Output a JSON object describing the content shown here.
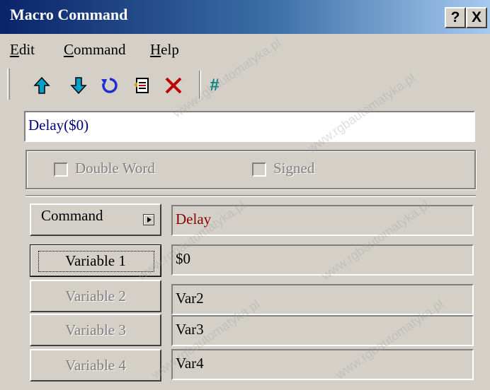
{
  "window": {
    "title": "Macro Command",
    "help_btn": "?",
    "close_btn": "X"
  },
  "menu": {
    "items": [
      {
        "label": "Edit",
        "accel": "E",
        "rest": "dit"
      },
      {
        "label": "Command",
        "accel": "C",
        "rest": "ommand"
      },
      {
        "label": "Help",
        "accel": "H",
        "rest": "elp"
      }
    ]
  },
  "toolbar": {
    "icons": [
      "arrow-up-icon",
      "arrow-down-icon",
      "undo-icon",
      "insert-doc-icon",
      "delete-x-icon",
      "hash-icon"
    ],
    "hash_label": "#",
    "colors": {
      "arrow": "#00a0c8",
      "undo": "#1e2fd0",
      "delete": "#c00000",
      "hash": "#008080"
    }
  },
  "expression": {
    "value": "Delay($0)"
  },
  "options": {
    "double_word": "Double Word",
    "signed": "Signed"
  },
  "fields": {
    "command": {
      "label": "Command",
      "value": "Delay"
    },
    "var1": {
      "label": "Variable 1",
      "value": "$0"
    },
    "var2": {
      "label": "Variable 2",
      "value": "Var2"
    },
    "var3": {
      "label": "Variable 3",
      "value": "Var3"
    },
    "var4": {
      "label": "Variable 4",
      "value": "Var4"
    }
  },
  "watermark": "www.rgbautomatyka.pl"
}
